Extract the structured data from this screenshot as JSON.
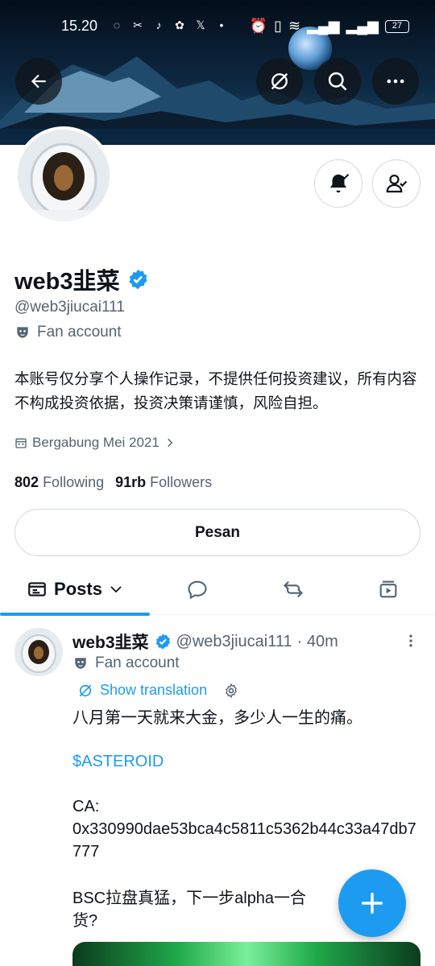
{
  "status_bar": {
    "time": "15.20",
    "battery": "27",
    "app_icons": [
      "whatsapp-icon",
      "capcut-icon",
      "tiktok-icon",
      "photos-icon",
      "x-icon"
    ]
  },
  "header": {
    "back": "back-arrow-icon",
    "actions": [
      "grok-icon",
      "search-icon",
      "more-icon"
    ]
  },
  "profile": {
    "name": "web3韭菜",
    "handle": "@web3jiucai111",
    "label": "Fan account",
    "bio": "本账号仅分享个人操作记录，不提供任何投资建议，所有内容不构成投资依据，投资决策请谨慎，风险自担。",
    "joined": "Bergabung Mei 2021",
    "following_count": "802",
    "following_label": "Following",
    "followers_count": "91rb",
    "followers_label": "Followers",
    "message_button": "Pesan"
  },
  "tabs": {
    "posts": "Posts"
  },
  "post": {
    "name": "web3韭菜",
    "handle": "@web3jiucai111",
    "time": "· 40m",
    "label": "Fan account",
    "translate": "Show translation",
    "line1": "八月第一天就来大金，多少人一生的痛。",
    "cashtag": "$ASTEROID",
    "ca_label": "CA:",
    "ca_value": "0x330990dae53bca4c5811c5362b44c33a47db7777",
    "line_last": "BSC拉盘真猛，下一步alpha一合",
    "line_last2": "货?"
  },
  "colors": {
    "accent": "#1d9bf0",
    "text": "#0f1419",
    "secondary": "#536471"
  }
}
